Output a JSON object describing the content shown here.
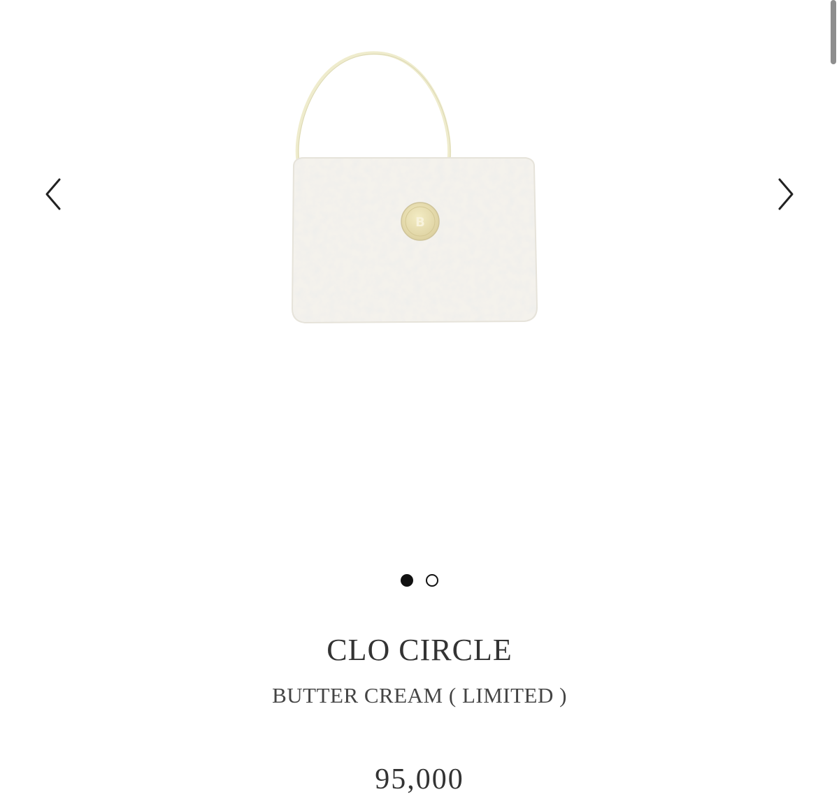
{
  "gallery": {
    "prev_icon": "chevron-left-icon",
    "next_icon": "chevron-right-icon",
    "slide_count": 2,
    "active_slide": 1
  },
  "product": {
    "name": "CLO CIRCLE",
    "variant": "BUTTER CREAM ( LIMITED )",
    "price": "95,000",
    "colors": {
      "bag_body": "#f4f2ec",
      "handle": "#efeccd",
      "logo_button": "#e8dfb0"
    }
  }
}
